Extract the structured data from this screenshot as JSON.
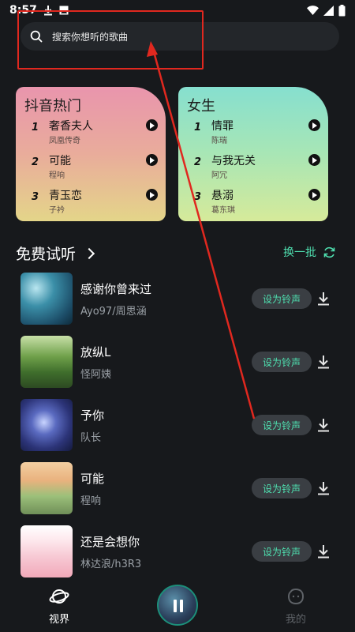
{
  "status_bar": {
    "time": "8:57"
  },
  "search": {
    "placeholder": "搜索你想听的歌曲"
  },
  "charts": [
    {
      "title": "抖音热门",
      "items": [
        {
          "rank": "1",
          "title": "奢香夫人",
          "artist": "凤凰传奇"
        },
        {
          "rank": "2",
          "title": "可能",
          "artist": "程响"
        },
        {
          "rank": "3",
          "title": "青玉恋",
          "artist": "子衿"
        }
      ]
    },
    {
      "title": "女生",
      "items": [
        {
          "rank": "1",
          "title": "情罪",
          "artist": "陈瑞"
        },
        {
          "rank": "2",
          "title": "与我无关",
          "artist": "阿冗"
        },
        {
          "rank": "3",
          "title": "悬溺",
          "artist": "葛东琪"
        }
      ]
    }
  ],
  "section": {
    "title": "免费试听",
    "batch_label": "换一批"
  },
  "songs": [
    {
      "title": "感谢你曾来过",
      "artist": "Ayo97/周思涵",
      "ringtone_label": "设为铃声"
    },
    {
      "title": "放纵L",
      "artist": "怪阿姨",
      "ringtone_label": "设为铃声"
    },
    {
      "title": "予你",
      "artist": "队长",
      "ringtone_label": "设为铃声"
    },
    {
      "title": "可能",
      "artist": "程响",
      "ringtone_label": "设为铃声"
    },
    {
      "title": "还是会想你",
      "artist": "林达浪/h3R3",
      "ringtone_label": "设为铃声"
    }
  ],
  "nav": {
    "discover_label": "视界",
    "mine_label": "我的"
  },
  "colors": {
    "accent": "#4fe0b0",
    "background": "#17191c",
    "annotation": "#e0281f"
  },
  "icons": {
    "search": "search-icon",
    "refresh": "refresh-icon",
    "download": "download-icon",
    "play": "play-icon",
    "pause": "pause-icon",
    "planet": "planet-icon",
    "face": "face-icon"
  }
}
